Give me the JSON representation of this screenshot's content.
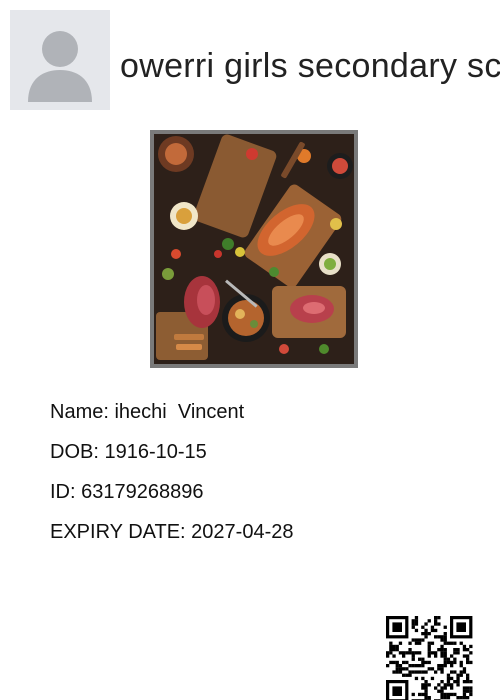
{
  "header": {
    "school_name": "owerri girls secondary school",
    "logo_icon": "default-avatar-icon"
  },
  "photo": {
    "icon": "food-platter-photo"
  },
  "fields": {
    "name_label": "Name: ",
    "name_value": "ihechi  Vincent",
    "dob_label": "DOB: ",
    "dob_value": "1916-10-15",
    "id_label": "ID: ",
    "id_value": "63179268896",
    "expiry_label": "EXPIRY DATE: ",
    "expiry_value": "2027-04-28"
  },
  "qr": {
    "icon": "qr-code-icon"
  },
  "colors": {
    "logo_background": "#e5e7eb",
    "avatar_fill": "#b0b3b8",
    "photo_border": "#7a7a7a"
  }
}
